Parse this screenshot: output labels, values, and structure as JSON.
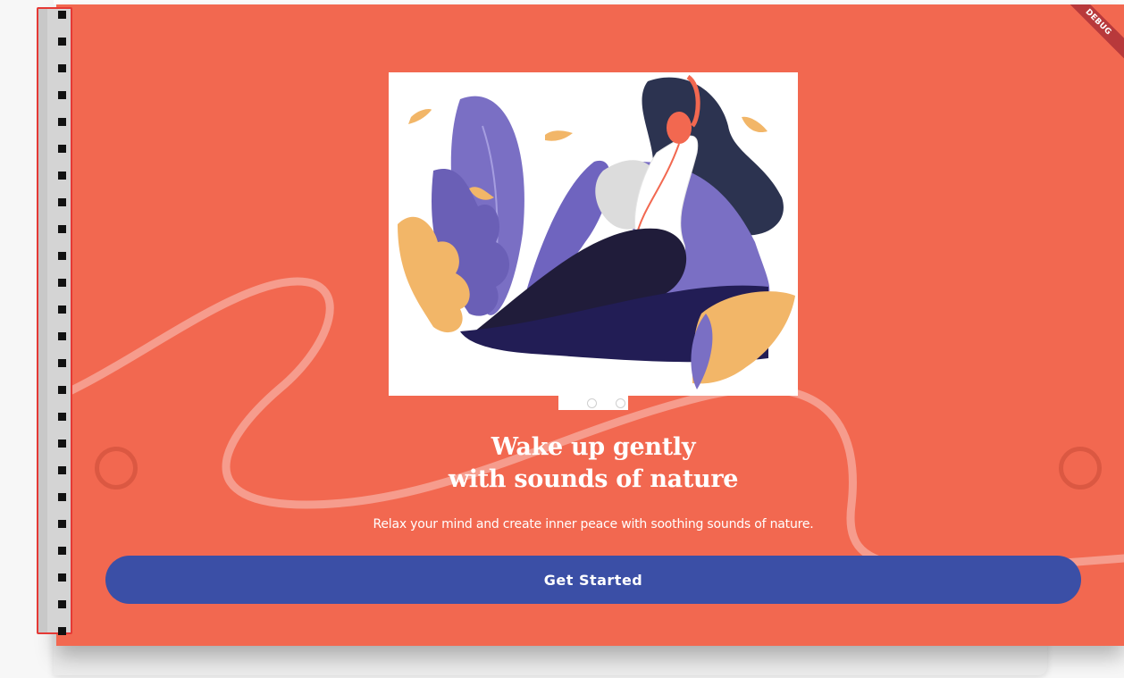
{
  "onboarding": {
    "headline_line1": "Wake up gently",
    "headline_line2": "with sounds of nature",
    "subtitle": "Relax your mind and create inner peace with soothing sounds of nature.",
    "cta_label": "Get Started",
    "page_indicator": {
      "total": 2,
      "current": 1
    }
  },
  "debug_banner": "DEBUG",
  "colors": {
    "background": "#f26850",
    "button": "#3b4fa6",
    "text": "#ffffff",
    "illustration_purple": "#7a6fc4",
    "illustration_navy": "#201c4a",
    "illustration_orange": "#f2b668"
  },
  "icons": [
    "left-nav-ring-icon",
    "right-nav-ring-icon"
  ]
}
